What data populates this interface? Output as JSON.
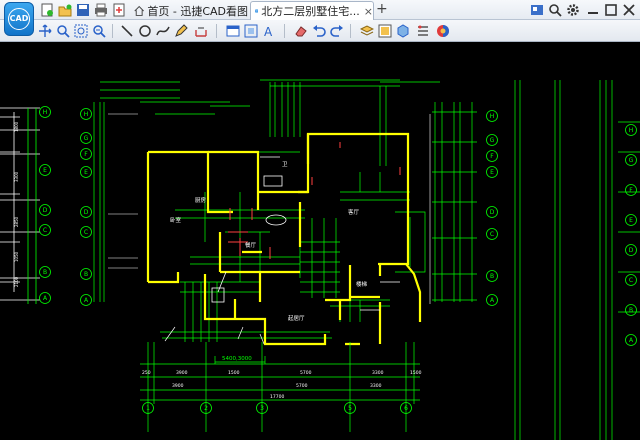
{
  "app": {
    "logo_text": "CAD"
  },
  "tabs": [
    {
      "label": "首页 - 迅捷CAD看图",
      "icon": "home-icon"
    },
    {
      "label": "北方二层别墅住宅...",
      "icon": "cad-file-icon",
      "close": "×"
    }
  ],
  "new_tab": "+",
  "toolbar": {
    "icons": [
      "pan-icon",
      "zoom-window-icon",
      "zoom-extents-icon",
      "zoom-realtime-icon",
      "line-icon",
      "circle-icon",
      "polyline-icon",
      "pencil-icon",
      "text-measure-icon",
      "rectangle-icon",
      "area-icon",
      "text-icon",
      "eraser-icon",
      "undo-icon",
      "redo-icon",
      "layers-icon",
      "layout-icon",
      "3d-box-icon",
      "properties-icon",
      "color-icon"
    ]
  },
  "drawing": {
    "left_ruler": [
      "1800",
      "3300",
      "2850",
      "1050",
      "2100"
    ],
    "axis_letters_left": [
      "H",
      "G",
      "F",
      "E",
      "D",
      "C",
      "B",
      "A"
    ],
    "axis_letters_right": [
      "H",
      "G",
      "F",
      "E",
      "D",
      "C",
      "B",
      "A"
    ],
    "bottom_dims_top": [
      "250",
      "3900",
      "1500",
      "5700",
      "3300",
      "1500"
    ],
    "bottom_dims_mid": [
      "3900",
      "5700",
      "3300"
    ],
    "bottom_total": "17700",
    "bottom_axes": [
      "1",
      "2",
      "3",
      "5",
      "6"
    ],
    "room_labels": [
      "卧室",
      "客厅",
      "餐厅",
      "起居厅",
      "厨房",
      "卫",
      "楼梯"
    ],
    "dim_note": "5400,3000"
  },
  "colors": {
    "wall": "#ffff00",
    "line": "#00ff00",
    "frame": "#ffffff",
    "accent": "#ff4040"
  }
}
